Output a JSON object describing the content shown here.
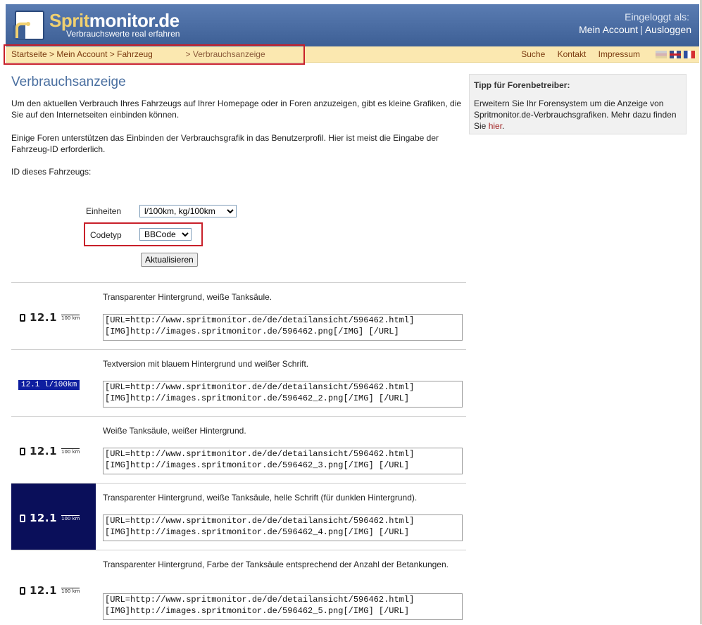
{
  "header": {
    "logo_sprit": "Sprit",
    "logo_rest": "monitor.de",
    "logo_subtitle": "Verbrauchswerte real erfahren",
    "login_label": "Eingeloggt als:",
    "my_account": "Mein Account",
    "separator": "|",
    "logout": "Ausloggen"
  },
  "breadcrumb": {
    "home": "Startseite",
    "account": "Mein Account",
    "vehicle": "Fahrzeug",
    "current": "Verbrauchsanzeige",
    "sep": ">"
  },
  "topnav": {
    "search": "Suche",
    "contact": "Kontakt",
    "imprint": "Impressum"
  },
  "main": {
    "title": "Verbrauchsanzeige",
    "intro1": "Um den aktuellen Verbrauch Ihres Fahrzeugs auf Ihrer Homepage oder in Foren anzuzeigen, gibt es kleine Grafiken, die Sie auf den Internetseiten einbinden können.",
    "intro2": "Einige Foren unterstützen das Einbinden der Verbrauchsgrafik in das Benutzerprofil. Hier ist meist die Eingabe der Fahrzeug-ID erforderlich.",
    "id_label": "ID dieses Fahrzeugs:",
    "units_label": "Einheiten",
    "units_value": "l/100km, kg/100km",
    "codetype_label": "Codetyp",
    "codetype_value": "BBCode",
    "update_button": "Aktualisieren"
  },
  "badge": {
    "value": "12.1",
    "unit": "100 km",
    "text_version": "12.1 l/100km"
  },
  "rows": [
    {
      "desc": "Transparenter Hintergrund, weiße Tanksäule.",
      "code": "[URL=http://www.spritmonitor.de/de/detailansicht/596462.html]\n[IMG]http://images.spritmonitor.de/596462.png[/IMG] [/URL]"
    },
    {
      "desc": "Textversion mit blauem Hintergrund und weißer Schrift.",
      "code": "[URL=http://www.spritmonitor.de/de/detailansicht/596462.html]\n[IMG]http://images.spritmonitor.de/596462_2.png[/IMG] [/URL]"
    },
    {
      "desc": "Weiße Tanksäule, weißer Hintergrund.",
      "code": "[URL=http://www.spritmonitor.de/de/detailansicht/596462.html]\n[IMG]http://images.spritmonitor.de/596462_3.png[/IMG] [/URL]"
    },
    {
      "desc": "Transparenter Hintergrund, weiße Tanksäule, helle Schrift (für dunklen Hintergrund).",
      "code": "[URL=http://www.spritmonitor.de/de/detailansicht/596462.html]\n[IMG]http://images.spritmonitor.de/596462_4.png[/IMG] [/URL]"
    },
    {
      "desc": "Transparenter Hintergrund, Farbe der Tanksäule entsprechend der Anzahl der Betankungen.",
      "code": "[URL=http://www.spritmonitor.de/de/detailansicht/596462.html]\n[IMG]http://images.spritmonitor.de/596462_5.png[/IMG] [/URL]"
    }
  ],
  "sidebar": {
    "tip_title": "Tipp für Forenbetreiber:",
    "tip_text": "Erweitern Sie Ihr Forensystem um die Anzeige von Spritmonitor.de-Verbrauchsgrafiken. Mehr dazu finden Sie ",
    "tip_link": "hier",
    "tip_end": "."
  },
  "colors": {
    "header_blue": "#3d5f95",
    "crumb_bar": "#fbe8b0",
    "highlight_red": "#c8202a",
    "dark_preview": "#0a0f5a",
    "text_badge_blue": "#0e1ea0",
    "title_blue": "#4a6fa0"
  }
}
